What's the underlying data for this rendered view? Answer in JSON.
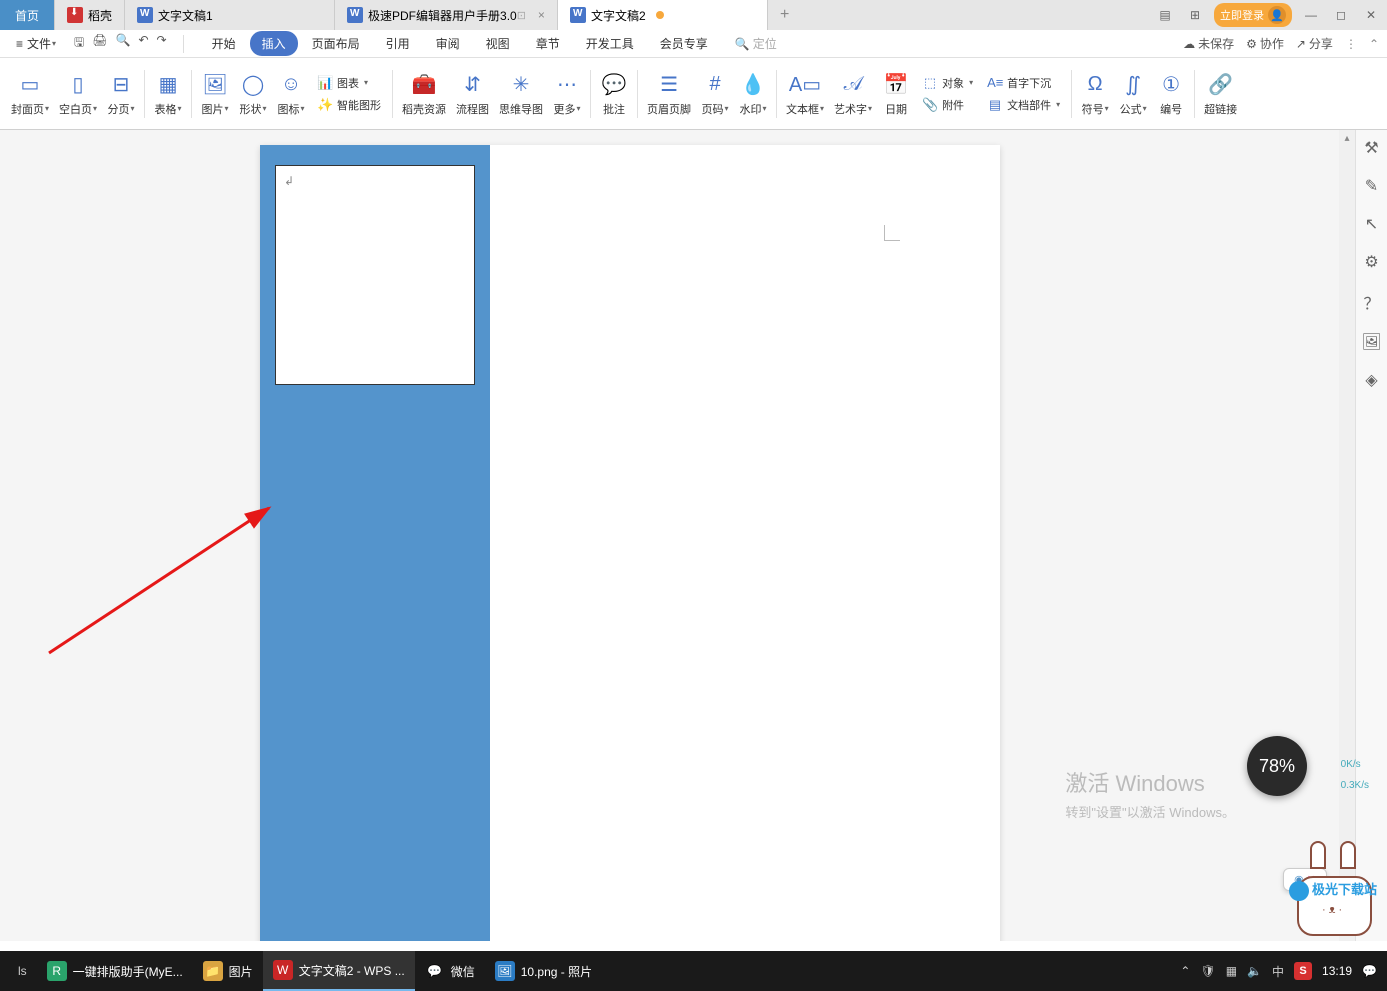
{
  "tabs": {
    "home": "首页",
    "doke": "稻壳",
    "doc1": "文字文稿1",
    "pdf": "极速PDF编辑器用户手册3.0",
    "doc2": "文字文稿2"
  },
  "login_label": "立即登录",
  "file_menu": "文件",
  "menu_tabs": {
    "start": "开始",
    "insert": "插入",
    "page_layout": "页面布局",
    "references": "引用",
    "review": "审阅",
    "view": "视图",
    "sections": "章节",
    "dev_tools": "开发工具",
    "member": "会员专享"
  },
  "locate_placeholder": "定位",
  "top_right": {
    "unsaved": "未保存",
    "collaborate": "协作",
    "share": "分享"
  },
  "ribbon": {
    "cover": "封面页",
    "blank": "空白页",
    "page_break": "分页",
    "table": "表格",
    "picture": "图片",
    "shapes": "形状",
    "icons": "图标",
    "chart": "图表",
    "smart_art": "智能图形",
    "doke_res": "稻壳资源",
    "flowchart": "流程图",
    "mindmap": "思维导图",
    "more": "更多",
    "annotation": "批注",
    "header_footer": "页眉页脚",
    "page_number": "页码",
    "watermark": "水印",
    "textbox": "文本框",
    "wordart": "艺术字",
    "date": "日期",
    "object": "对象",
    "attachment": "附件",
    "drop_cap": "首字下沉",
    "doc_parts": "文档部件",
    "symbol": "符号",
    "equation": "公式",
    "numbering": "编号",
    "hyperlink": "超链接"
  },
  "watermark": {
    "line1": "激活 Windows",
    "line2": "转到\"设置\"以激活 Windows。"
  },
  "speed": {
    "percent": "78%",
    "up": "0K/s",
    "down": "0.3K/s"
  },
  "tab_popup": "✕",
  "jg_site": "极光下载站",
  "taskbar": {
    "myeasy": "一键排版助手(MyE...",
    "pictures": "图片",
    "wps": "文字文稿2 - WPS ...",
    "wechat": "微信",
    "photos": "10.png - 照片",
    "ime": "中",
    "time": "13:19"
  }
}
